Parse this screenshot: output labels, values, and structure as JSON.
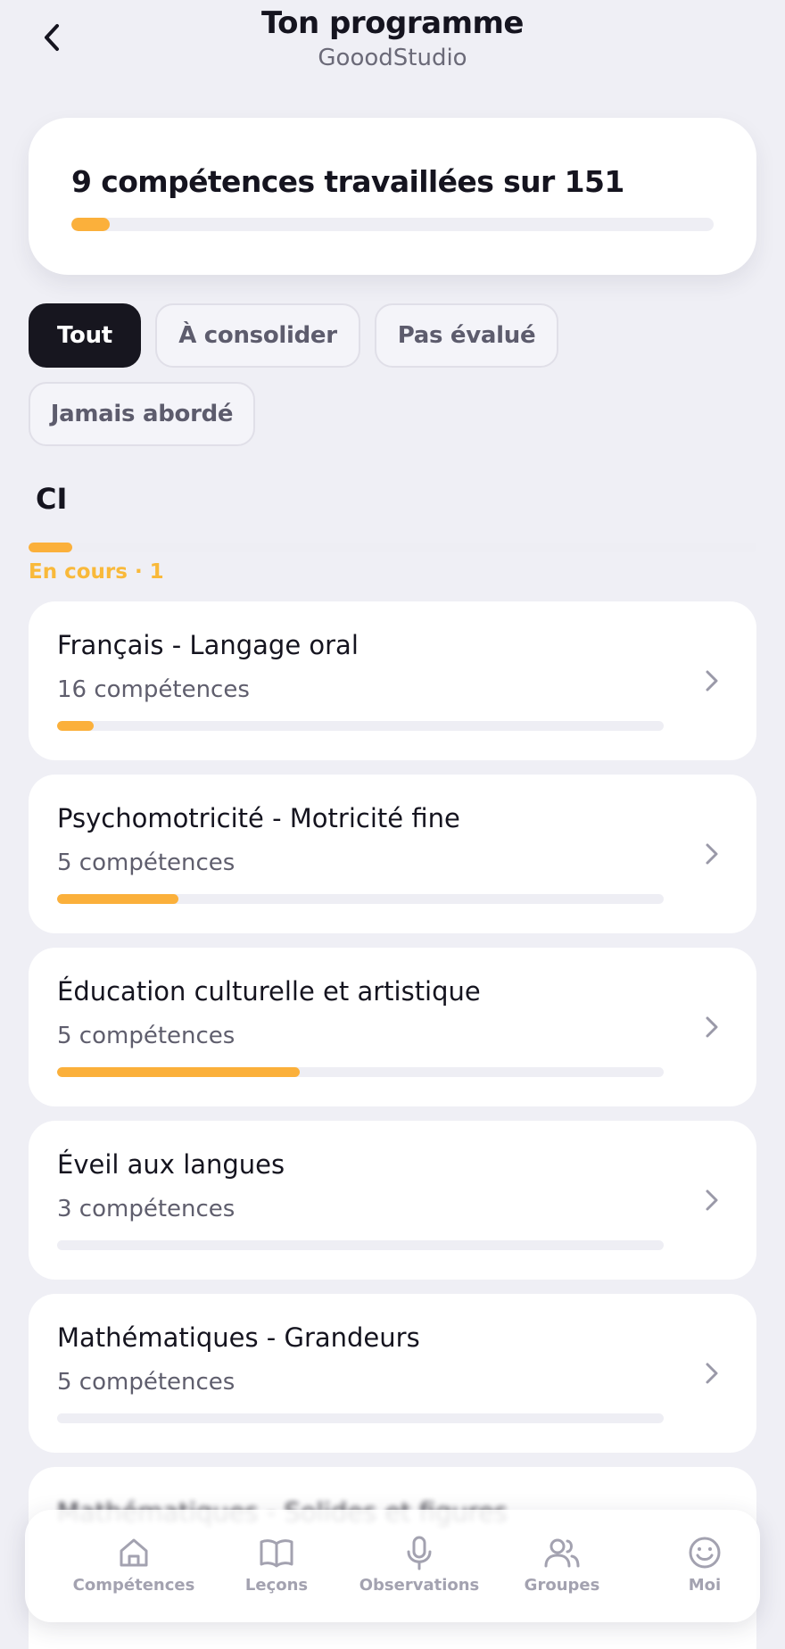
{
  "header": {
    "title": "Ton programme",
    "subtitle": "GooodStudio",
    "back_icon": "chevron-left-icon"
  },
  "summary": {
    "text": "9 compétences travaillées sur 151",
    "progress": 0.06
  },
  "filters": [
    {
      "label": "Tout",
      "active": true
    },
    {
      "label": "À consolider",
      "active": false
    },
    {
      "label": "Pas évalué",
      "active": false
    },
    {
      "label": "Jamais abordé",
      "active": false
    }
  ],
  "section": {
    "title": "CI",
    "status": "En cours · 1",
    "progress": 0.06
  },
  "subjects": [
    {
      "title": "Français - Langage oral",
      "count": "16 compétences",
      "progress": 0.06
    },
    {
      "title": "Psychomotricité - Motricité fine",
      "count": "5 compétences",
      "progress": 0.2
    },
    {
      "title": "Éducation culturelle et artistique",
      "count": "5 compétences",
      "progress": 0.4
    },
    {
      "title": "Éveil aux langues",
      "count": "3 compétences",
      "progress": 0
    },
    {
      "title": "Mathématiques - Grandeurs",
      "count": "5 compétences",
      "progress": 0
    },
    {
      "title": "Mathématiques - Solides et figures",
      "count": "",
      "progress": 0
    }
  ],
  "tabbar": [
    {
      "label": "Compétences",
      "icon": "home-icon"
    },
    {
      "label": "Leçons",
      "icon": "book-icon"
    },
    {
      "label": "Observations",
      "icon": "microphone-icon"
    },
    {
      "label": "Groupes",
      "icon": "users-icon"
    },
    {
      "label": "Moi",
      "icon": "smiley-icon"
    }
  ],
  "colors": {
    "accent": "#fbb03b",
    "status": "#f9b93a",
    "chip_active": "#17161f",
    "background": "#efeff5"
  }
}
